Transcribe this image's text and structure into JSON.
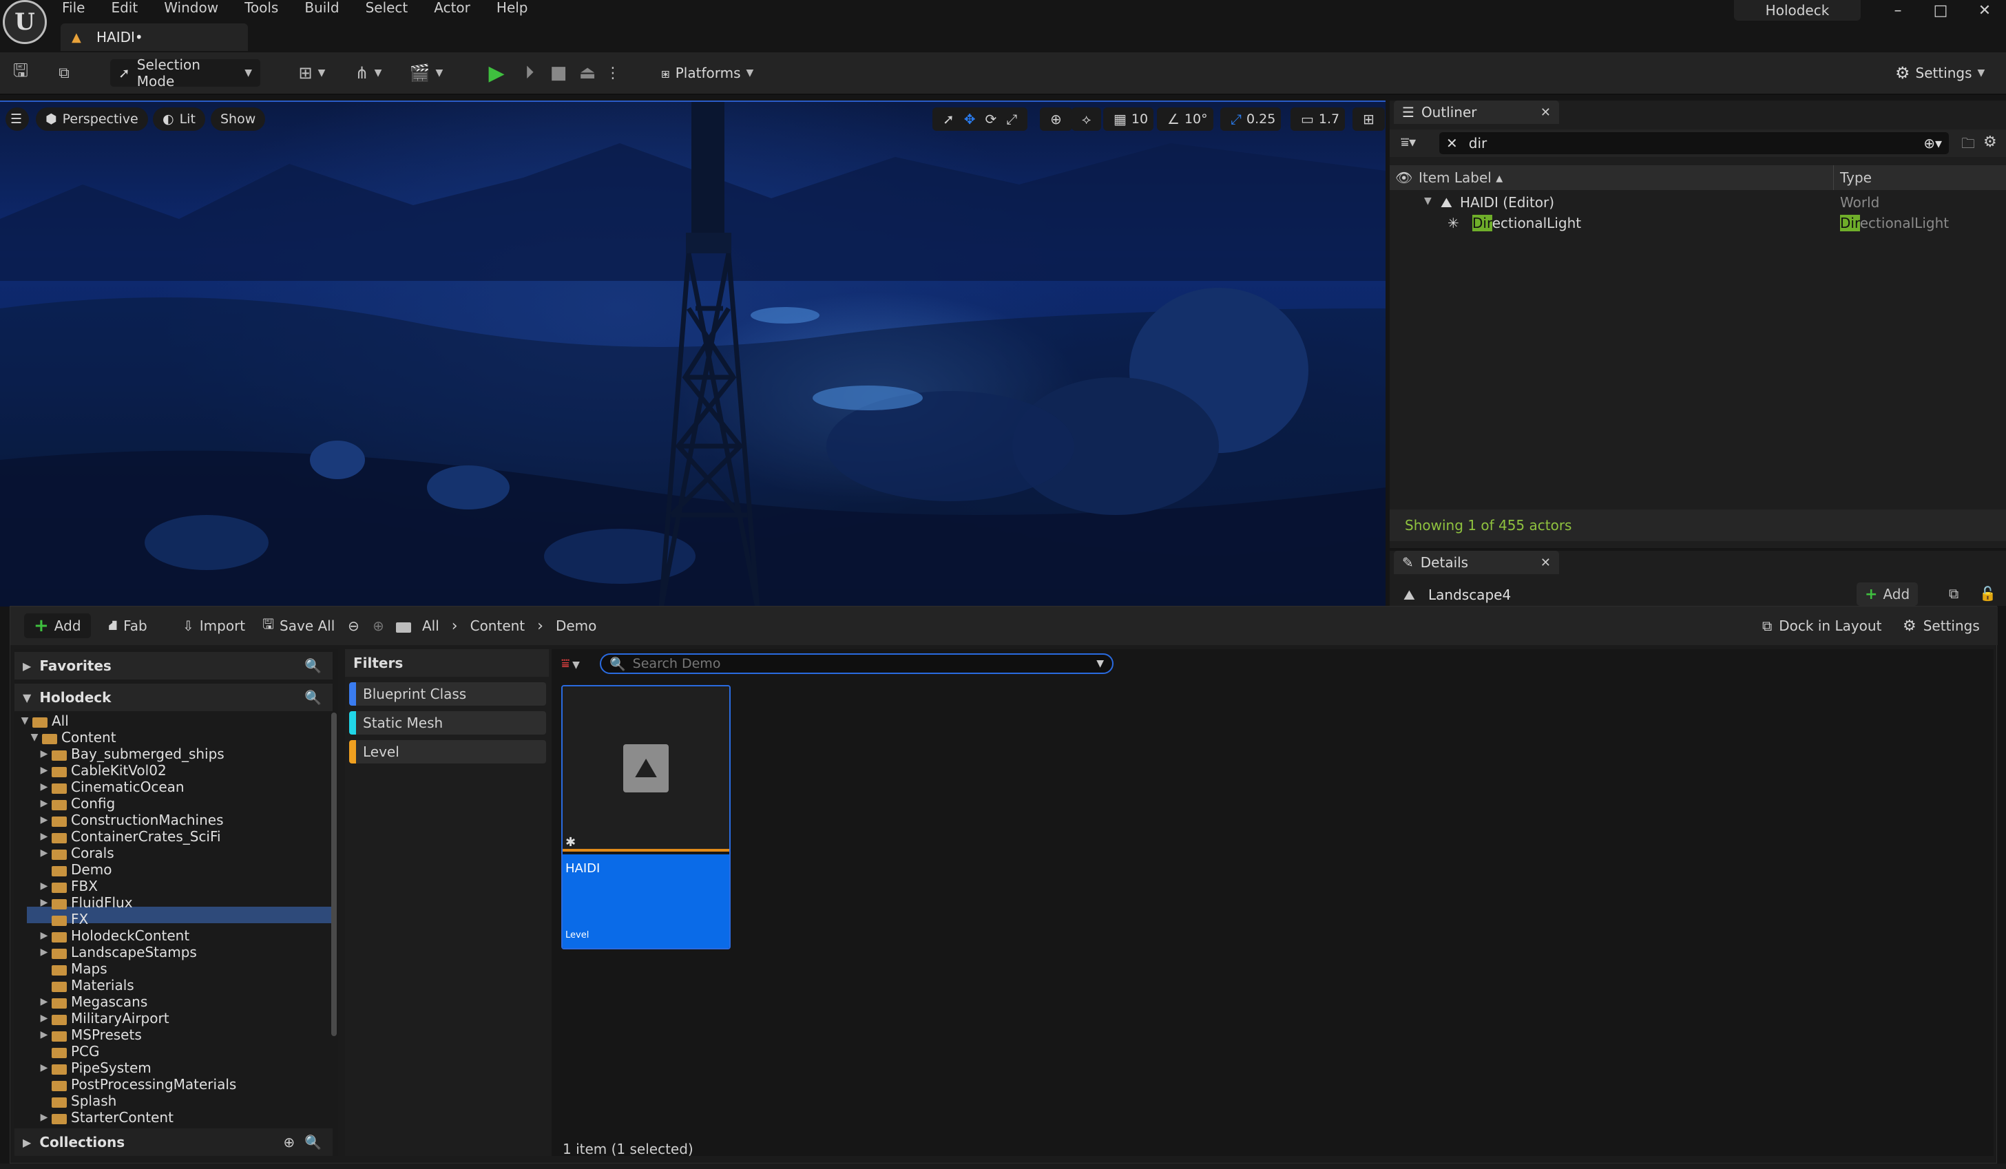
{
  "menu": [
    "File",
    "Edit",
    "Window",
    "Tools",
    "Build",
    "Select",
    "Actor",
    "Help"
  ],
  "document_tab": "HAIDI•",
  "project_name": "Holodeck",
  "logo_letter": "U",
  "toolbar": {
    "selection_mode": "Selection Mode",
    "platforms": "Platforms",
    "settings": "Settings"
  },
  "viewport": {
    "perspective": "Perspective",
    "lit": "Lit",
    "show": "Show",
    "grid_snap": "10",
    "rotation_snap": "10°",
    "scale_snap": "0.25",
    "camera_speed": "1.7"
  },
  "outliner": {
    "tab": "Outliner",
    "search_value": "dir",
    "col_label": "Item Label ▴",
    "col_type": "Type",
    "rows": [
      {
        "label": "HAIDI (Editor)",
        "type": "World"
      },
      {
        "label_hl": "Dir",
        "label_rest": "ectionalLight",
        "type_hl": "Dir",
        "type_rest": "ectionalLight"
      }
    ],
    "footer": "Showing 1 of 455 actors"
  },
  "details": {
    "tab": "Details",
    "object": "Landscape4",
    "add": "Add"
  },
  "content_browser": {
    "add": "Add",
    "fab": "Fab",
    "import": "Import",
    "save_all": "Save All",
    "breadcrumb": [
      "All",
      "Content",
      "Demo"
    ],
    "dock_in_layout": "Dock in Layout",
    "settings": "Settings",
    "favorites": "Favorites",
    "holodeck": "Holodeck",
    "collections": "Collections",
    "tree": [
      {
        "label": "All",
        "depth": 0,
        "arrow": "▼"
      },
      {
        "label": "Content",
        "depth": 1,
        "arrow": "▼"
      },
      {
        "label": "Bay_submerged_ships",
        "depth": 2,
        "arrow": "▶"
      },
      {
        "label": "CableKitVol02",
        "depth": 2,
        "arrow": "▶"
      },
      {
        "label": "CinematicOcean",
        "depth": 2,
        "arrow": "▶"
      },
      {
        "label": "Config",
        "depth": 2,
        "arrow": "▶"
      },
      {
        "label": "ConstructionMachines",
        "depth": 2,
        "arrow": "▶"
      },
      {
        "label": "ContainerCrates_SciFi",
        "depth": 2,
        "arrow": "▶"
      },
      {
        "label": "Corals",
        "depth": 2,
        "arrow": "▶"
      },
      {
        "label": "Demo",
        "depth": 2,
        "arrow": ""
      },
      {
        "label": "FBX",
        "depth": 2,
        "arrow": "▶"
      },
      {
        "label": "FluidFlux",
        "depth": 2,
        "arrow": "▶"
      },
      {
        "label": "FX",
        "depth": 2,
        "arrow": ""
      },
      {
        "label": "HolodeckContent",
        "depth": 2,
        "arrow": "▶"
      },
      {
        "label": "LandscapeStamps",
        "depth": 2,
        "arrow": "▶"
      },
      {
        "label": "Maps",
        "depth": 2,
        "arrow": ""
      },
      {
        "label": "Materials",
        "depth": 2,
        "arrow": ""
      },
      {
        "label": "Megascans",
        "depth": 2,
        "arrow": "▶"
      },
      {
        "label": "MilitaryAirport",
        "depth": 2,
        "arrow": "▶"
      },
      {
        "label": "MSPresets",
        "depth": 2,
        "arrow": "▶"
      },
      {
        "label": "PCG",
        "depth": 2,
        "arrow": ""
      },
      {
        "label": "PipeSystem",
        "depth": 2,
        "arrow": "▶"
      },
      {
        "label": "PostProcessingMaterials",
        "depth": 2,
        "arrow": ""
      },
      {
        "label": "Splash",
        "depth": 2,
        "arrow": ""
      },
      {
        "label": "StarterContent",
        "depth": 2,
        "arrow": "▶"
      }
    ],
    "filters_title": "Filters",
    "filters": [
      {
        "label": "Blueprint Class",
        "color": "#3a7cf0"
      },
      {
        "label": "Static Mesh",
        "color": "#21d6e8"
      },
      {
        "label": "Level",
        "color": "#f0a020"
      }
    ],
    "search_placeholder": "Search Demo",
    "asset": {
      "name": "HAIDI",
      "type": "Level"
    },
    "status": "1 item (1 selected)"
  }
}
